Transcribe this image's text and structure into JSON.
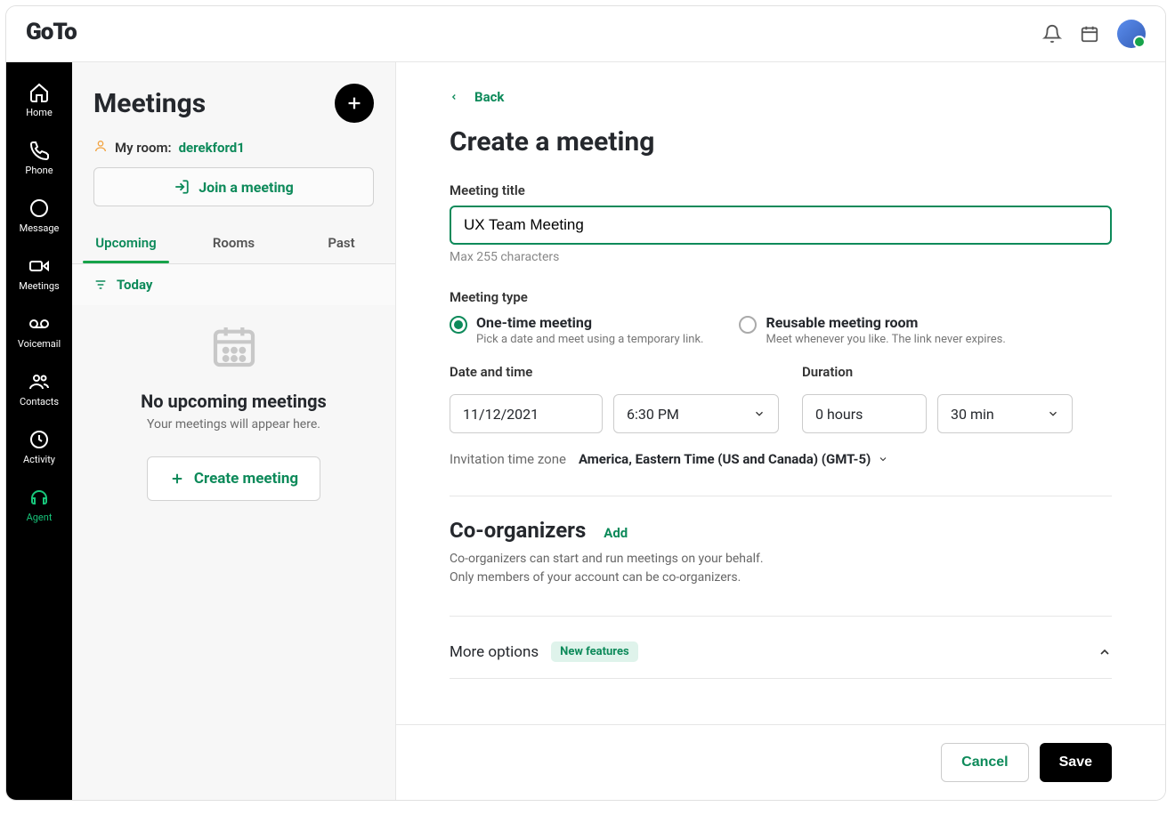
{
  "brand": "GoTo",
  "nav": {
    "home": "Home",
    "phone": "Phone",
    "message": "Message",
    "meetings": "Meetings",
    "voicemail": "Voicemail",
    "contacts": "Contacts",
    "activity": "Activity",
    "agent": "Agent"
  },
  "midpanel": {
    "title": "Meetings",
    "myroom_label": "My room:",
    "myroom_id": "derekford1",
    "join_label": "Join a meeting",
    "tabs": {
      "upcoming": "Upcoming",
      "rooms": "Rooms",
      "past": "Past"
    },
    "today": "Today",
    "empty_title": "No upcoming meetings",
    "empty_sub": "Your meetings will appear here.",
    "create_label": "Create meeting"
  },
  "form": {
    "back": "Back",
    "page_title": "Create a meeting",
    "title_label": "Meeting title",
    "title_value": "UX Team Meeting",
    "title_hint": "Max 255 characters",
    "type_label": "Meeting type",
    "type_one_title": "One-time meeting",
    "type_one_sub": "Pick a date and meet using a temporary link.",
    "type_reuse_title": "Reusable meeting room",
    "type_reuse_sub": "Meet whenever you like. The link never expires.",
    "dt_label": "Date and time",
    "date_value": "11/12/2021",
    "time_value": "6:30 PM",
    "duration_label": "Duration",
    "hours_value": "0 hours",
    "mins_value": "30 min",
    "tz_label": "Invitation time zone",
    "tz_value": "America, Eastern Time (US and Canada) (GMT-5)",
    "co_title": "Co-organizers",
    "co_add": "Add",
    "co_text1": "Co-organizers can start and run meetings on your behalf.",
    "co_text2": "Only members of your account can be co-organizers.",
    "more_title": "More options",
    "more_badge": "New features",
    "cancel": "Cancel",
    "save": "Save"
  }
}
